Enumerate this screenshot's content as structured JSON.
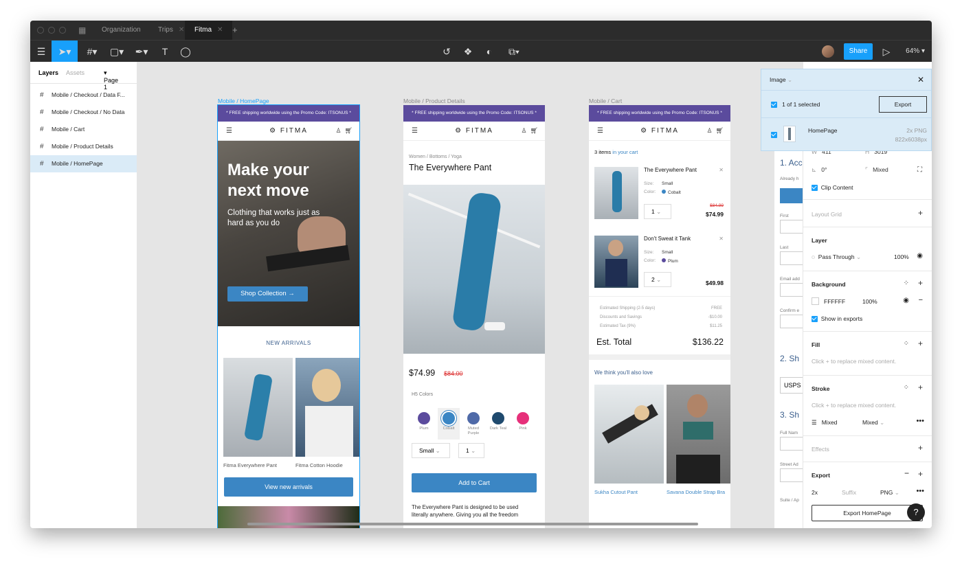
{
  "titlebar": {
    "tabs": [
      {
        "label": "Organization"
      },
      {
        "label": "Trips"
      },
      {
        "label": "Fitma"
      }
    ]
  },
  "toolbar": {
    "share_label": "Share",
    "zoom": "64%"
  },
  "left_panel": {
    "tab_layers": "Layers",
    "tab_assets": "Assets",
    "page": "Page 1",
    "layers": [
      {
        "label": "Mobile / Checkout / Data F..."
      },
      {
        "label": "Mobile / Checkout / No Data"
      },
      {
        "label": "Mobile / Cart"
      },
      {
        "label": "Mobile / Product Details"
      },
      {
        "label": "Mobile / HomePage"
      }
    ]
  },
  "frames": {
    "home": {
      "label": "Mobile / HomePage",
      "promo": "* FREE shipping worldwide using the Promo Code: ITSONUS *",
      "logo": "FITMA",
      "hero_title": "Make your next move",
      "hero_sub": "Clothing that works just as hard as you do",
      "hero_cta": "Shop Collection →",
      "section_title": "NEW ARRIVALS",
      "item1": "Fitma Everywhere Pant",
      "item2": "Fitma Cotton Hoodie",
      "cta": "View new arrivals"
    },
    "product": {
      "label": "Mobile / Product Details",
      "promo": "* FREE shipping worldwide using the Promo Code: ITSONUS *",
      "logo": "FITMA",
      "breadcrumb": "Women / Bottoms / Yoga",
      "title": "The Everywhere Pant",
      "price": "$74.99",
      "old_price": "$84.00",
      "colors_label": "H5 Colors",
      "swatches": [
        {
          "name": "Plum",
          "color": "#5b4b9d"
        },
        {
          "name": "Cobalt",
          "color": "#3b86c4"
        },
        {
          "name": "Muted Purple",
          "color": "#4f6aa8"
        },
        {
          "name": "Dark Teal",
          "color": "#1f4a6e"
        },
        {
          "name": "Pink",
          "color": "#e6307a"
        }
      ],
      "size_value": "Small",
      "qty_value": "1",
      "add_to_cart": "Add to Cart",
      "description": "The Everywhere Pant is designed to be used literally anywhere. Giving you all the freedom"
    },
    "cart": {
      "label": "Mobile / Cart",
      "promo": "* FREE shipping worldwide using the Promo Code: ITSONUS *",
      "logo": "FITMA",
      "count_bold": "3 items",
      "count_rest": " in your cart",
      "items": [
        {
          "name": "The Everywhere Pant",
          "size_label": "Size:",
          "size": "Small",
          "color_label": "Color:",
          "color": "Cobalt",
          "swatch": "#3b86c4",
          "qty": "1",
          "old_price": "$84.99",
          "price": "$74.99"
        },
        {
          "name": "Don't Sweat it Tank",
          "size_label": "Size:",
          "size": "Small",
          "color_label": "Color:",
          "color": "Plum",
          "swatch": "#5b4b9d",
          "qty": "2",
          "old_price": "",
          "price": "$49.98"
        }
      ],
      "summary": [
        {
          "label": "Estimated Shipping (2-5 days)",
          "value": "FREE"
        },
        {
          "label": "Discounts and Savings",
          "value": "-$10.00"
        },
        {
          "label": "Estimated Tax (9%)",
          "value": "$11.25"
        }
      ],
      "total_label": "Est. Total",
      "total_value": "$136.22",
      "also_love": "We think you'll also love",
      "rec1": "Sukha Cutout Pant",
      "rec2": "Savana Double Strap Bra"
    }
  },
  "export_popup": {
    "title": "Image",
    "selected": "1 of 1 selected",
    "export_btn": "Export",
    "item_name": "HomePage",
    "item_format": "2x PNG",
    "item_size": "822x6038px"
  },
  "right_panel": {
    "w_label": "W",
    "w_value": "411",
    "h_label": "H",
    "h_value": "3019",
    "rotation": "0°",
    "radius": "Mixed",
    "clip_content": "Clip Content",
    "layout_grid": "Layout Grid",
    "layer": "Layer",
    "blend": "Pass Through",
    "opacity": "100%",
    "background": "Background",
    "bg_hex": "FFFFFF",
    "bg_opacity": "100%",
    "show_in_exports": "Show in exports",
    "fill": "Fill",
    "fill_hint": "Click + to replace mixed content.",
    "stroke": "Stroke",
    "stroke_hint": "Click + to replace mixed content.",
    "stroke_a": "Mixed",
    "stroke_b": "Mixed",
    "effects": "Effects",
    "export": "Export",
    "export_scale": "2x",
    "export_suffix": "Suffix",
    "export_format": "PNG",
    "export_button": "Export HomePage"
  },
  "peek": {
    "items": [
      "1. Acc",
      "Already h",
      "First",
      "Last",
      "Email add",
      "Confirm e",
      "2. Sh",
      "USPS",
      "3. Sh",
      "Full Nam",
      "Street Ad",
      "Suite / Ap"
    ]
  }
}
